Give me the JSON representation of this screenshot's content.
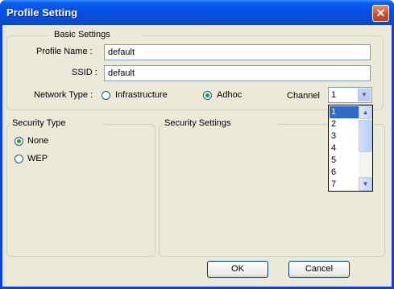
{
  "window": {
    "title": "Profile Setting",
    "close_glyph": "✕"
  },
  "basic": {
    "group_label": "Basic Settings",
    "profile_name_label": "Profile Name :",
    "profile_name_value": "default",
    "ssid_label": "SSID :",
    "ssid_value": "default",
    "network_type_label": "Network Type :",
    "infrastructure_label": "Infrastructure",
    "adhoc_label": "Adhoc",
    "selected_network_type": "Adhoc",
    "channel_label": "Channel",
    "channel_value": "1",
    "channel_options": [
      "1",
      "2",
      "3",
      "4",
      "5",
      "6",
      "7"
    ]
  },
  "security_type": {
    "group_label": "Security Type",
    "options": [
      "None",
      "WEP"
    ],
    "selected": "None"
  },
  "security_settings": {
    "group_label": "Security Settings"
  },
  "buttons": {
    "ok": "OK",
    "cancel": "Cancel"
  },
  "colors": {
    "title_bar": "#0550e6",
    "client": "#ece9d8",
    "selection": "#316ac5",
    "close": "#d44a24"
  }
}
